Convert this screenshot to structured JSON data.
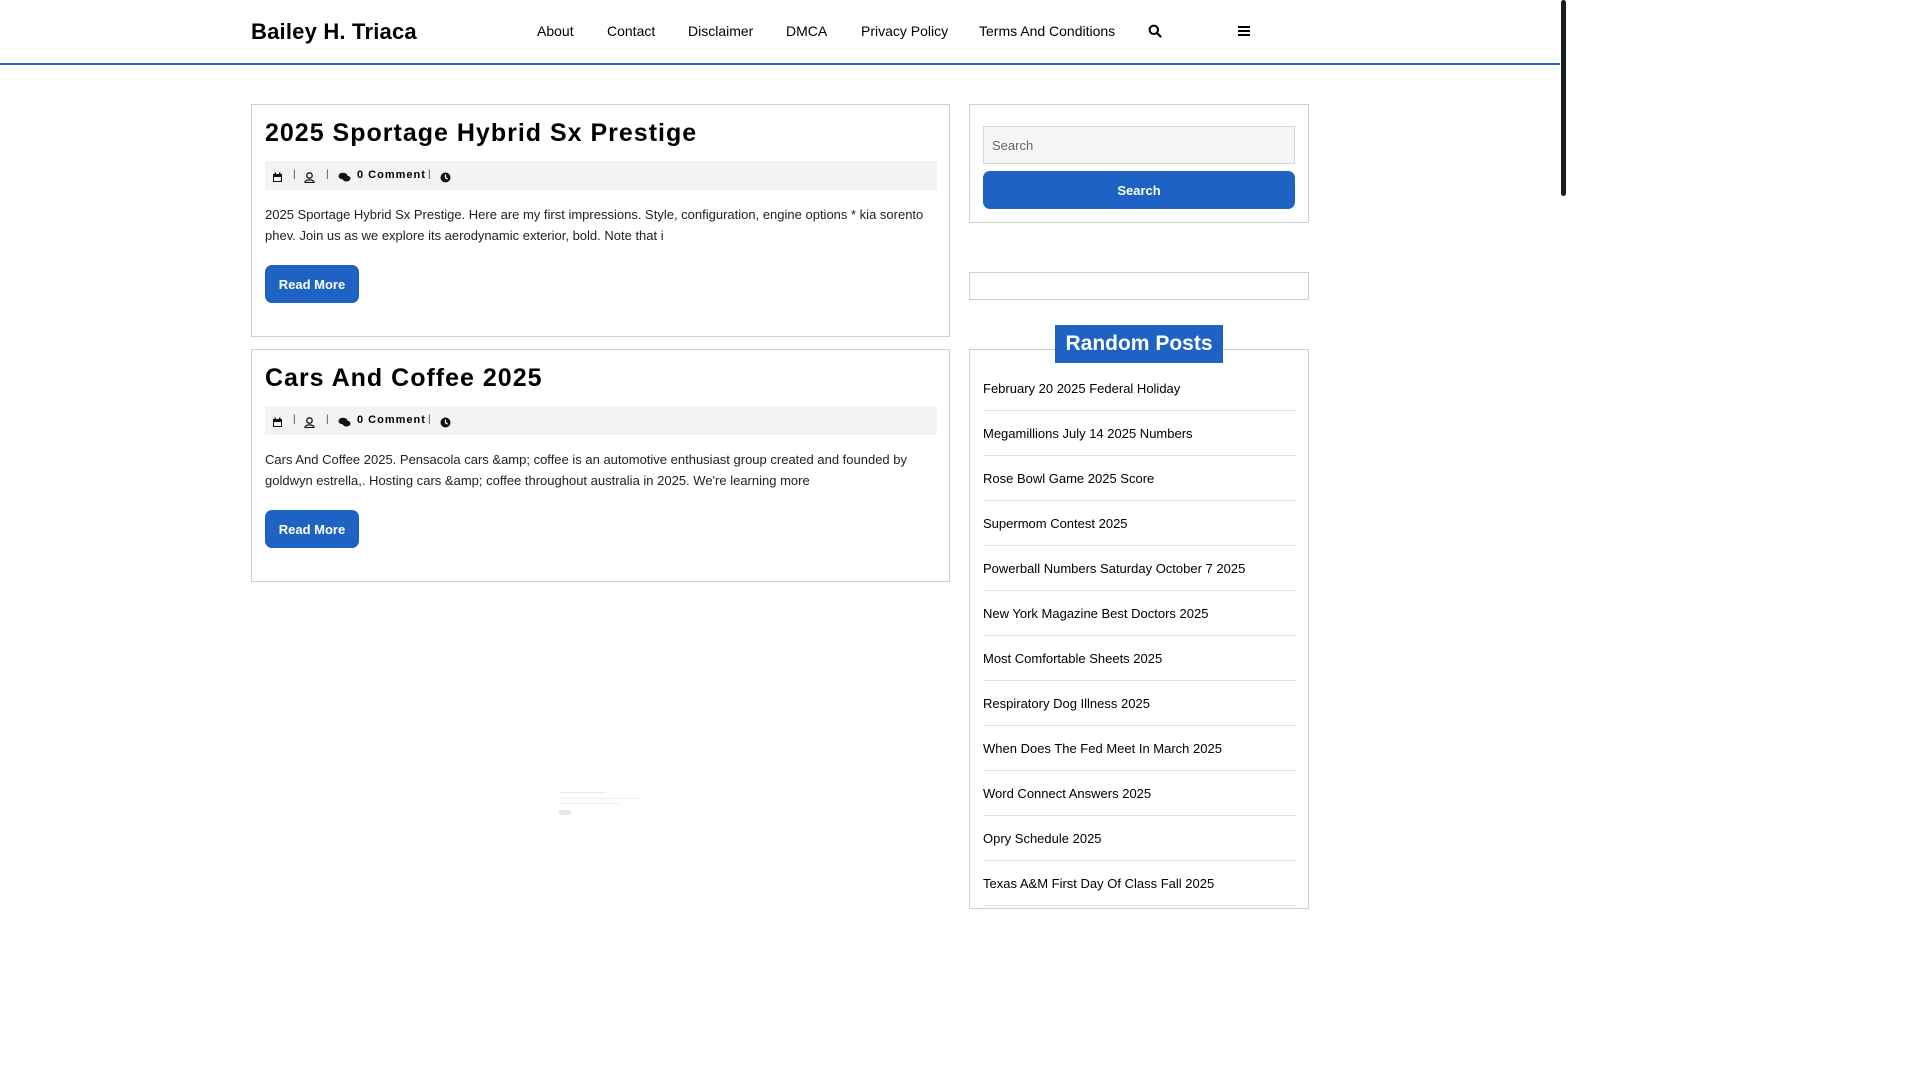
{
  "site": {
    "title": "Bailey H. Triaca"
  },
  "nav": {
    "items": [
      {
        "label": "About"
      },
      {
        "label": "Contact"
      },
      {
        "label": "Disclaimer"
      },
      {
        "label": "DMCA"
      },
      {
        "label": "Privacy Policy"
      },
      {
        "label": "Terms And Conditions"
      }
    ],
    "icons": [
      "search-icon",
      "menu-icon"
    ]
  },
  "posts": [
    {
      "title": "2025 Sportage Hybrid Sx Prestige",
      "comments": "0 Comment",
      "excerpt": "2025 Sportage Hybrid Sx Prestige. Here are my first impressions. Style, configuration, engine options * kia sorento phev. Join us as we explore its aerodynamic exterior, bold. Note that i",
      "read_more": "Read More"
    },
    {
      "title": "Cars And Coffee 2025",
      "comments": "0 Comment",
      "excerpt": "Cars And Coffee 2025. Pensacola cars &amp; coffee is an automotive enthusiast group created and founded by goldwyn estrella,. Hosting cars &amp; coffee throughout australia in 2025. We're learning more",
      "read_more": "Read More"
    }
  ],
  "sidebar": {
    "search": {
      "placeholder": "Search",
      "button": "Search"
    },
    "random_posts": {
      "title": "Random Posts",
      "items": [
        "February 20 2025 Federal Holiday",
        "Megamillions July 14 2025 Numbers",
        "Rose Bowl Game 2025 Score",
        "Supermom Contest 2025",
        "Powerball Numbers Saturday October 7 2025",
        "New York Magazine Best Doctors 2025",
        "Most Comfortable Sheets 2025",
        "Respiratory Dog Illness 2025",
        "When Does The Fed Meet In March 2025",
        "Word Connect Answers 2025",
        "Opry Schedule 2025",
        "Texas A&M First Day Of Class Fall 2025"
      ]
    }
  },
  "colors": {
    "accent": "#1e63c4",
    "border": "#cfcfcf",
    "meta_bg": "#f3f3f3"
  }
}
